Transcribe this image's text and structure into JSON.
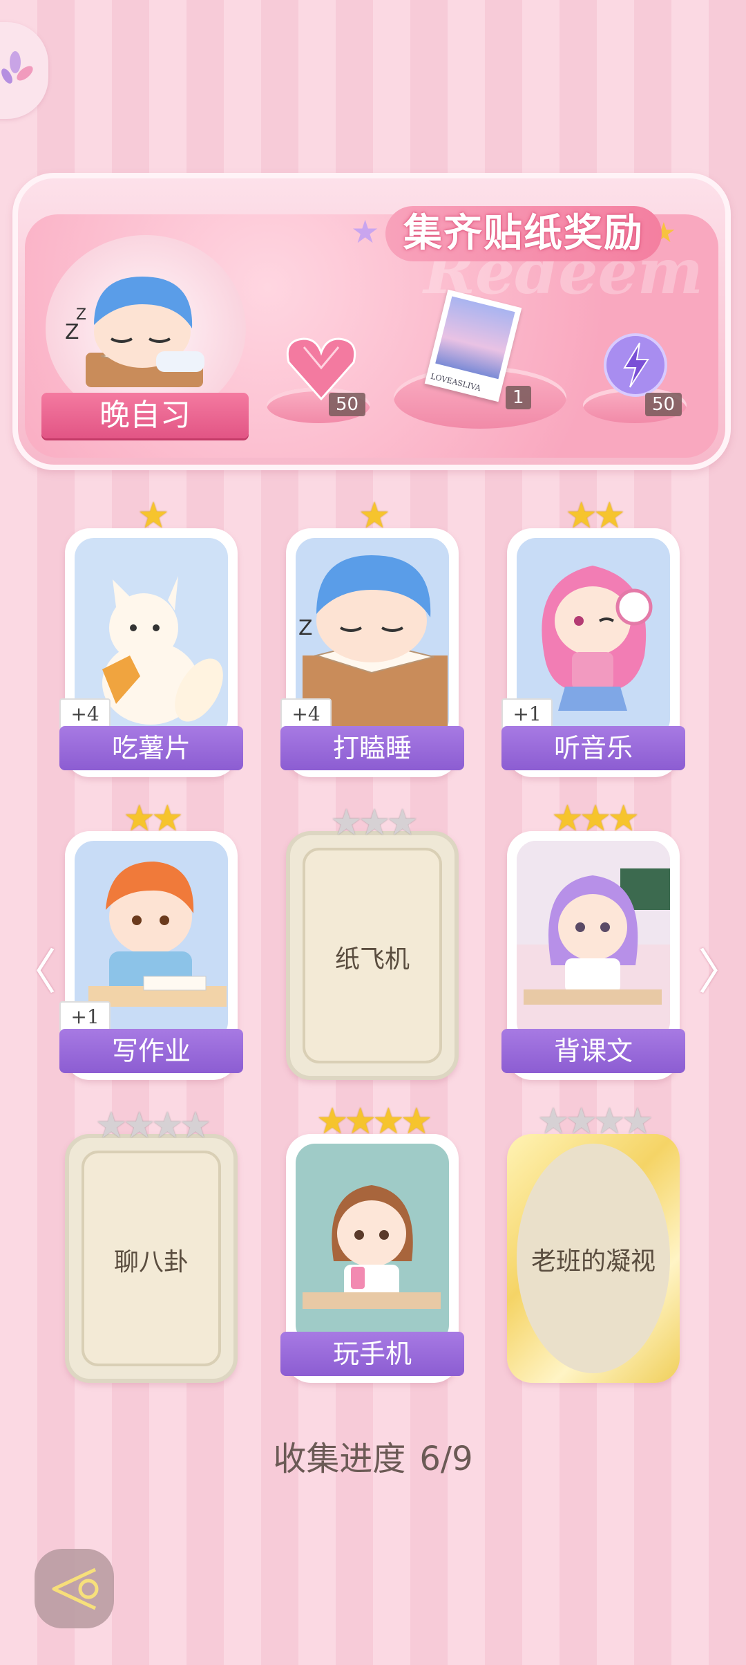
{
  "banner": {
    "title": "集齐贴纸奖励",
    "watermark": "Redeem",
    "avatar_label": "晚自习",
    "rewards": [
      {
        "icon": "pink-heart-gem-icon",
        "count": "50"
      },
      {
        "icon": "photo-card-icon",
        "count": "1",
        "photo_caption": "LOVEASLIVA"
      },
      {
        "icon": "lightning-orb-icon",
        "count": "50"
      }
    ]
  },
  "cards": [
    {
      "name": "吃薯片",
      "stars": 1,
      "max_stars": 1,
      "bonus": "+4",
      "unlocked": true
    },
    {
      "name": "打瞌睡",
      "stars": 1,
      "max_stars": 1,
      "bonus": "+4",
      "unlocked": true
    },
    {
      "name": "听音乐",
      "stars": 2,
      "max_stars": 2,
      "bonus": "+1",
      "unlocked": true
    },
    {
      "name": "写作业",
      "stars": 2,
      "max_stars": 2,
      "bonus": "+1",
      "unlocked": true
    },
    {
      "name": "纸飞机",
      "stars": 0,
      "max_stars": 3,
      "unlocked": false
    },
    {
      "name": "背课文",
      "stars": 3,
      "max_stars": 3,
      "unlocked": true
    },
    {
      "name": "聊八卦",
      "stars": 0,
      "max_stars": 4,
      "unlocked": false
    },
    {
      "name": "玩手机",
      "stars": 4,
      "max_stars": 4,
      "unlocked": true
    },
    {
      "name": "老班的凝视",
      "stars": 0,
      "max_stars": 4,
      "unlocked": false
    }
  ],
  "progress": {
    "label": "收集进度",
    "value": "6/9"
  },
  "colors": {
    "accent_purple": "#9b6bdc",
    "banner_pink": "#f47fa0",
    "star_gold": "#f6c42d"
  }
}
